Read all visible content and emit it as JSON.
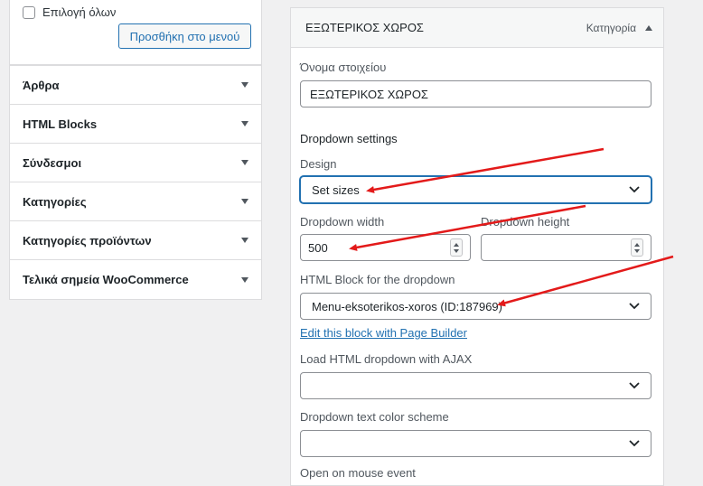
{
  "left_panel": {
    "select_all_label": "Επιλογή όλων",
    "add_to_menu_button": "Προσθήκη στο μενού",
    "accordion": [
      {
        "label": "Άρθρα"
      },
      {
        "label": "HTML Blocks"
      },
      {
        "label": "Σύνδεσμοι"
      },
      {
        "label": "Κατηγορίες"
      },
      {
        "label": "Κατηγορίες προϊόντων"
      },
      {
        "label": "Τελικά σημεία WooCommerce"
      }
    ]
  },
  "menu_item": {
    "title": "ΕΞΩΤΕΡΙΚΟΣ ΧΩΡΟΣ",
    "type_label": "Κατηγορία",
    "name_label": "Όνομα στοιχείου",
    "name_value": "ΕΞΩΤΕΡΙΚΟΣ ΧΩΡΟΣ",
    "dropdown_settings_title": "Dropdown settings",
    "design_label": "Design",
    "design_value": "Set sizes",
    "dropdown_width_label": "Dropdown width",
    "dropdown_width_value": "500",
    "dropdown_height_label": "Dropdown height",
    "dropdown_height_value": "",
    "html_block_label": "HTML Block for the dropdown",
    "html_block_value": "Menu-eksoterikos-xoros (ID:187969)",
    "edit_block_link": "Edit this block with Page Builder",
    "ajax_label": "Load HTML dropdown with AJAX",
    "ajax_value": "",
    "color_scheme_label": "Dropdown text color scheme",
    "color_scheme_value": "",
    "mouse_event_label": "Open on mouse event"
  },
  "colors": {
    "accent": "#2271b1",
    "annotation_arrow": "#e31a1a"
  }
}
